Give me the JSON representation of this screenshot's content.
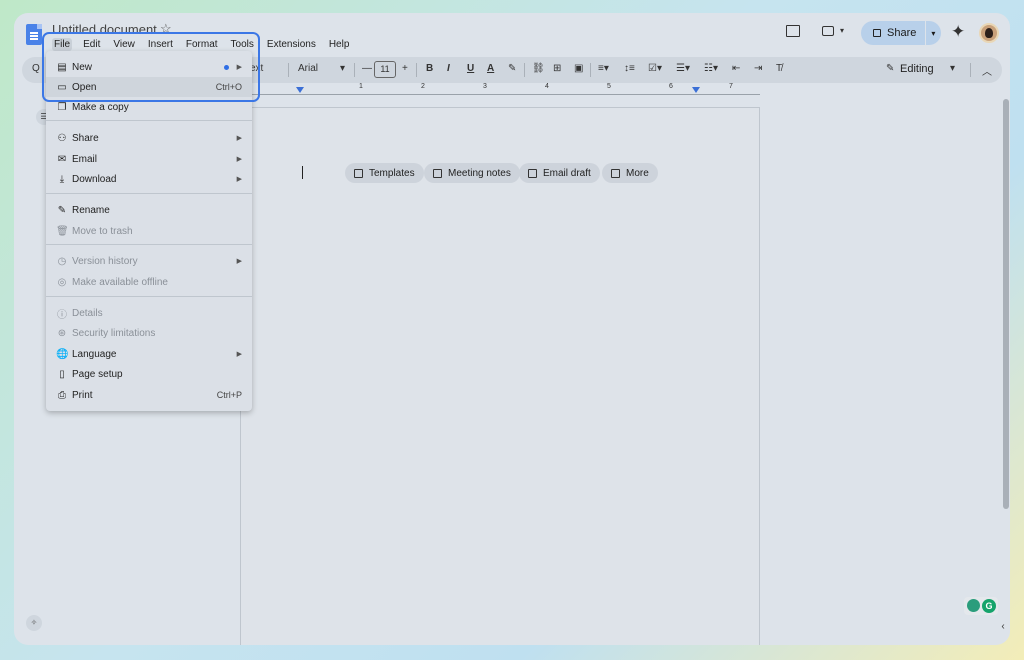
{
  "doc": {
    "title": "Untitled document"
  },
  "menubar": [
    "File",
    "Edit",
    "View",
    "Insert",
    "Format",
    "Tools",
    "Extensions",
    "Help"
  ],
  "header": {
    "share_label": "Share"
  },
  "toolbar": {
    "style_label": "ext",
    "font": "Arial",
    "font_size": "11",
    "editing_mode": "Editing"
  },
  "ruler": {
    "numbers": [
      "1",
      "2",
      "3",
      "4",
      "5",
      "6",
      "7"
    ]
  },
  "chips": [
    {
      "label": "Templates"
    },
    {
      "label": "Meeting notes"
    },
    {
      "label": "Email draft"
    },
    {
      "label": "More"
    }
  ],
  "file_menu": {
    "items": [
      {
        "label": "New",
        "has_dot": true,
        "submenu": true
      },
      {
        "label": "Open",
        "shortcut": "Ctrl+O"
      },
      {
        "label": "Make a copy"
      },
      {
        "label": "Share",
        "submenu": true
      },
      {
        "label": "Email",
        "submenu": true
      },
      {
        "label": "Download",
        "submenu": true
      },
      {
        "label": "Rename"
      },
      {
        "label": "Move to trash",
        "disabled": true
      },
      {
        "label": "Version history",
        "submenu": true,
        "disabled": true
      },
      {
        "label": "Make available offline",
        "disabled": true
      },
      {
        "label": "Details",
        "disabled": true
      },
      {
        "label": "Security limitations",
        "disabled": true
      },
      {
        "label": "Language",
        "submenu": true
      },
      {
        "label": "Page setup"
      },
      {
        "label": "Print",
        "shortcut": "Ctrl+P"
      }
    ]
  },
  "colors": {
    "accent": "#3b77e6",
    "share_bg": "#b8d0ea",
    "window_bg": "#dde3ea"
  }
}
